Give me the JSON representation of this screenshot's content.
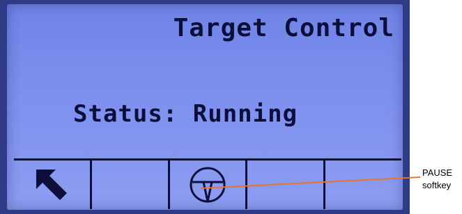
{
  "screen": {
    "title": "Target Control",
    "status_text": "Status: Running"
  },
  "softkeys": [
    {
      "icon": "arrow-up-left-icon",
      "label": "back"
    },
    {
      "icon": "",
      "label": ""
    },
    {
      "icon": "pause-steering-wheel-icon",
      "label": ""
    },
    {
      "icon": "",
      "label": ""
    },
    {
      "icon": "",
      "label": ""
    }
  ],
  "callout": {
    "line1": "PAUSE",
    "line2": "softkey"
  },
  "colors": {
    "bezel": "#2f3b86",
    "screen": "#7c8fee",
    "ink": "#0b0f3a",
    "callout_line": "#e8742a"
  }
}
